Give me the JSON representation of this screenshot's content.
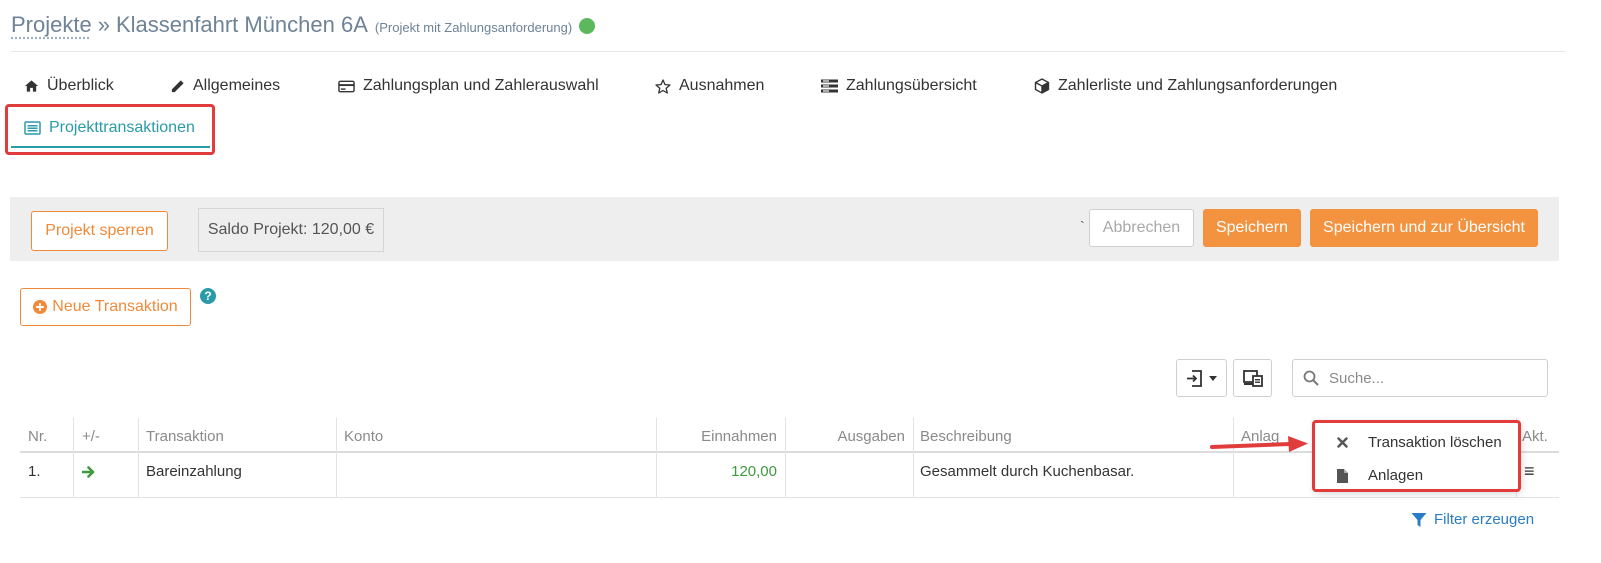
{
  "header": {
    "breadcrumb_root": "Projekte",
    "separator": "»",
    "project_name": "Klassenfahrt München 6A",
    "project_type": "(Projekt mit Zahlungsanforderung)",
    "status_color": "#5cb85c"
  },
  "tabs": [
    {
      "label": "Überblick",
      "icon": "home-icon"
    },
    {
      "label": "Allgemeines",
      "icon": "pencil-icon"
    },
    {
      "label": "Zahlungsplan und Zahlerauswahl",
      "icon": "credit-card-icon"
    },
    {
      "label": "Ausnahmen",
      "icon": "star-icon"
    },
    {
      "label": "Zahlungsübersicht",
      "icon": "list-icon"
    },
    {
      "label": "Zahlerliste und Zahlungsanforderungen",
      "icon": "cube-icon"
    },
    {
      "label": "Projekttransaktionen",
      "icon": "transactions-icon",
      "active": true
    }
  ],
  "toolbar": {
    "lock_label": "Projekt sperren",
    "saldo_label": "Saldo Projekt: 120,00 €",
    "backtick": "`",
    "cancel_label": "Abbrechen",
    "save_label": "Speichern",
    "save_overview_label": "Speichern und zur Übersicht"
  },
  "new_transaction_label": "Neue Transaktion",
  "help_glyph": "?",
  "search": {
    "placeholder": "Suche..."
  },
  "table": {
    "columns": [
      "Nr.",
      "+/-",
      "Transaktion",
      "Konto",
      "Einnahmen",
      "Ausgaben",
      "Beschreibung",
      "Anlag",
      "Akt."
    ],
    "rows": [
      {
        "nr": "1.",
        "direction": "in",
        "transaktion": "Bareinzahlung",
        "konto": "",
        "einnahmen": "120,00",
        "ausgaben": "",
        "beschreibung": "Gesammelt durch Kuchenbasar.",
        "action_glyph": "≡"
      }
    ]
  },
  "row_menu": {
    "items": [
      {
        "label": "Transaktion löschen",
        "icon": "times-icon"
      },
      {
        "label": "Anlagen",
        "icon": "file-icon"
      }
    ]
  },
  "filter_label": "Filter erzeugen",
  "colors": {
    "accent_teal": "#2a9ba8",
    "orange": "#f3923f",
    "annotation_red": "#e03c3c",
    "income_green": "#3e9a3e",
    "link_blue": "#2a7cc7"
  }
}
